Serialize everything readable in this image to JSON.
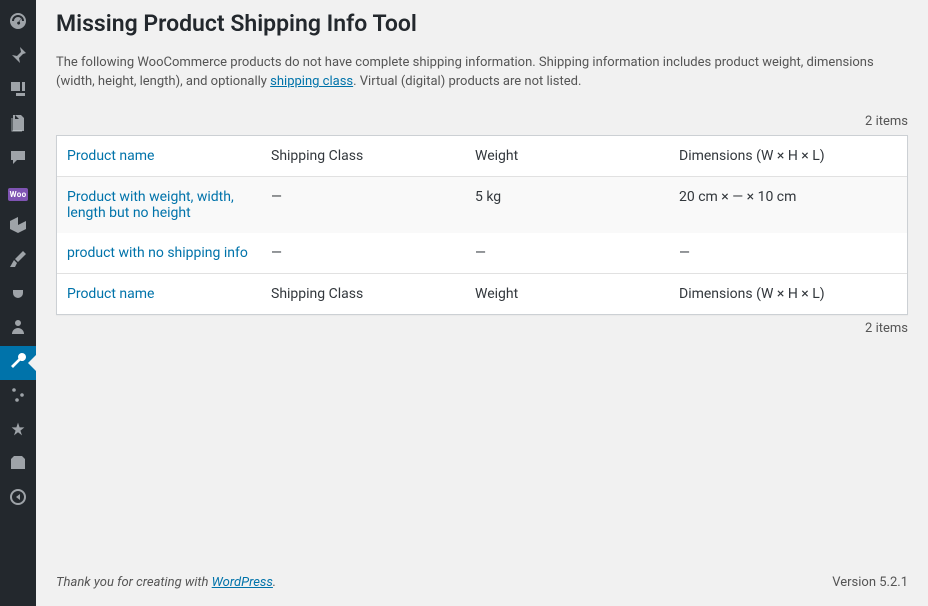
{
  "sidebar": {
    "items": [
      {
        "name": "dashboard"
      },
      {
        "name": "posts"
      },
      {
        "name": "media"
      },
      {
        "name": "pages"
      },
      {
        "name": "comments"
      },
      {
        "name": "woocommerce"
      },
      {
        "name": "products"
      },
      {
        "name": "appearance"
      },
      {
        "name": "plugins"
      },
      {
        "name": "users"
      },
      {
        "name": "tools",
        "active": true
      },
      {
        "name": "settings"
      },
      {
        "name": "seo"
      },
      {
        "name": "misc"
      },
      {
        "name": "collapse"
      }
    ]
  },
  "page": {
    "title": "Missing Product Shipping Info Tool",
    "intro_part1": "The following WooCommerce products do not have complete shipping information. Shipping information includes product weight, dimensions (width, height, length), and optionally ",
    "intro_link": "shipping class",
    "intro_part2": ". Virtual (digital) products are not listed."
  },
  "table": {
    "count_label_top": "2 items",
    "count_label_bottom": "2 items",
    "columns": {
      "product_name": "Product name",
      "shipping_class": "Shipping Class",
      "weight": "Weight",
      "dimensions": "Dimensions (W × H × L)"
    },
    "rows": [
      {
        "product_name": "Product with weight, width, length but no height",
        "shipping_class": "—",
        "weight": "5 kg",
        "dimensions": "20 cm × — × 10 cm"
      },
      {
        "product_name": "product with no shipping info",
        "shipping_class": "—",
        "weight": "—",
        "dimensions": "—"
      }
    ]
  },
  "footer": {
    "thank_text": "Thank you for creating with ",
    "wp_link": "WordPress",
    "thank_suffix": ".",
    "version": "Version 5.2.1"
  }
}
